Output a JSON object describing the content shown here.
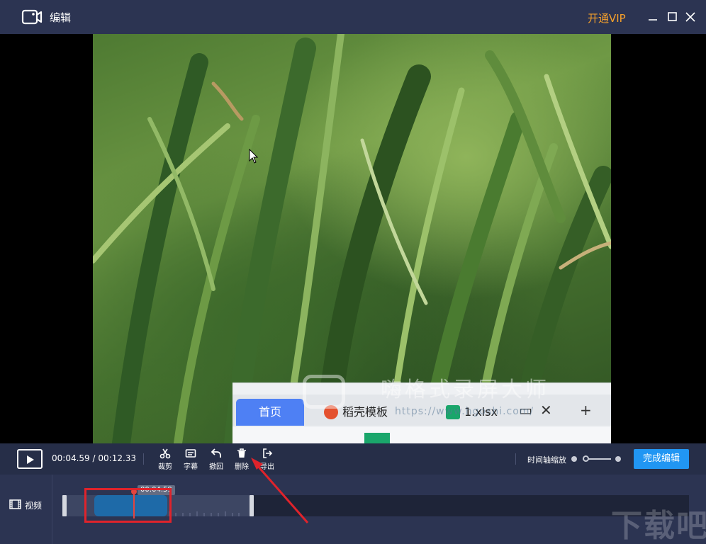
{
  "window": {
    "title": "编辑",
    "vip_label": "开通VIP"
  },
  "preview": {
    "embedded_screen": {
      "tab_home": "首页",
      "tab_template": "稻壳模板",
      "tab_file": "1.xlsx",
      "watermark_text": "嗨格式录屏大师",
      "watermark_url": "https://www.hgoshi.com/"
    }
  },
  "toolbar": {
    "current_time": "00:04.59",
    "separator": "/",
    "total_time": "00:12.33",
    "tools": [
      {
        "label": "裁剪",
        "icon": "scissors-icon"
      },
      {
        "label": "字幕",
        "icon": "subtitle-icon"
      },
      {
        "label": "撤回",
        "icon": "undo-icon"
      },
      {
        "label": "删除",
        "icon": "trash-icon"
      },
      {
        "label": "导出",
        "icon": "export-icon"
      }
    ],
    "zoom_label": "时间轴缩放",
    "zoom_level": 0.1,
    "done_label": "完成编辑"
  },
  "timeline": {
    "track_label": "视频",
    "playhead_time": "00:04.59"
  },
  "site_watermark": "下载吧",
  "colors": {
    "titlebar": "#2c3452",
    "vip": "#f7a12b",
    "accent": "#2196f3",
    "selection": "#1e6aa8",
    "playhead": "#e4453e",
    "annotation": "#e0232b"
  }
}
